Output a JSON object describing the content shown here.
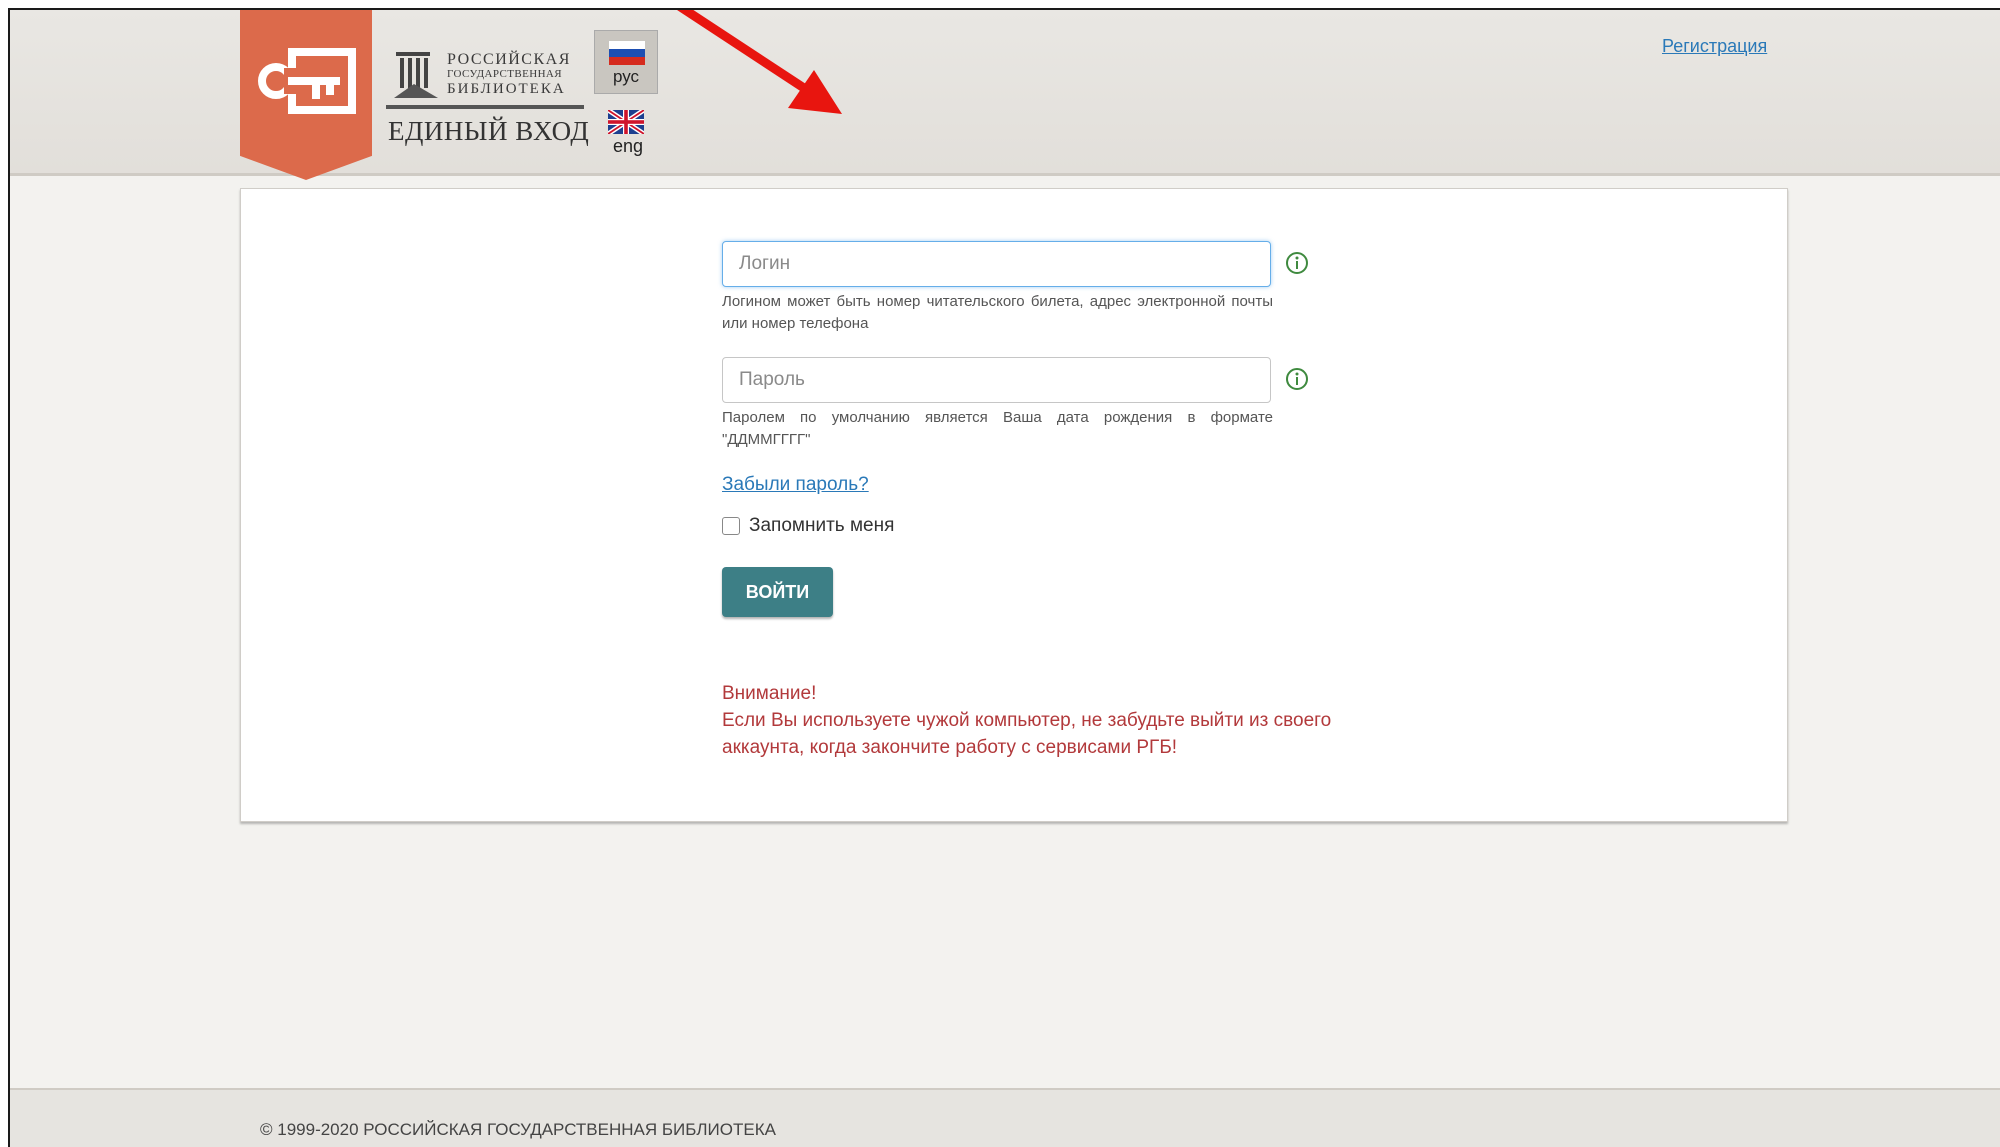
{
  "header": {
    "library_name_lines": [
      "РОССИЙСКАЯ",
      "ГОСУДАРСТВЕННАЯ",
      "БИБЛИОТЕКА"
    ],
    "service_title": "ЕДИНЫЙ ВХОД",
    "register_link": "Регистрация",
    "languages": [
      {
        "label": "рус",
        "active": true,
        "icon": "russia-flag-icon"
      },
      {
        "label": "eng",
        "active": false,
        "icon": "uk-flag-icon"
      }
    ]
  },
  "form": {
    "login": {
      "placeholder": "Логин",
      "value": "",
      "hint": "Логином может быть номер читательского билета, адрес электронной почты или номер телефона"
    },
    "password": {
      "placeholder": "Пароль",
      "value": "",
      "hint": "Паролем по умолчанию является Ваша дата рождения в формате \"ДДММГГГГ\""
    },
    "forgot_password": "Забыли пароль?",
    "remember_me": {
      "label": "Запомнить меня",
      "checked": false
    },
    "submit_label": "ВОЙТИ"
  },
  "warning": {
    "title": "Внимание!",
    "line1": "Если Вы используете чужой компьютер, не забудьте выйти из своего",
    "line2": "аккаунта, когда закончите работу с сервисами РГБ!"
  },
  "footer": {
    "copyright": "© 1999-2020 РОССИЙСКАЯ ГОСУДАРСТВЕННАЯ БИБЛИОТЕКА"
  },
  "colors": {
    "brand_orange": "#dc6a4b",
    "button_teal": "#3d7f86",
    "link_blue": "#2a79b8",
    "warning_red": "#b2393b",
    "annotation_arrow": "#e8150f"
  }
}
